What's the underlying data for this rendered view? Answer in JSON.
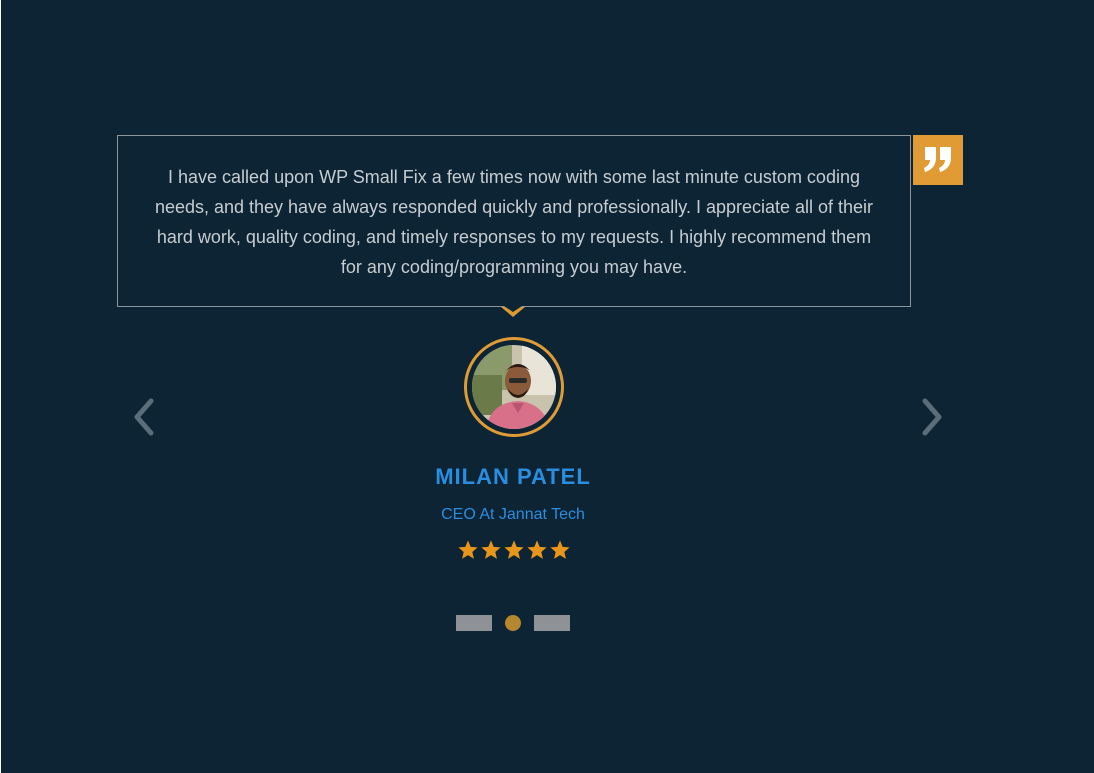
{
  "testimonial": {
    "quote": "I have called upon WP Small Fix a few times now with some last minute custom coding needs, and they have always responded quickly and professionally. I appreciate all of their hard work, quality coding, and timely responses to my requests. I highly recommend them for any coding/programming you may have.",
    "name": "MILAN PATEL",
    "role": "CEO At Jannat Tech",
    "rating": 5,
    "rating_max": 5
  },
  "icons": {
    "quote": "quote-icon",
    "prev": "chevron-left-icon",
    "next": "chevron-right-icon",
    "star": "star-icon"
  },
  "slider": {
    "total_slides": 3,
    "active_slide": 2
  },
  "colors": {
    "background": "#0c2434",
    "accent": "#e09b34",
    "name": "#2b8de0",
    "text": "#c7ccd0"
  }
}
